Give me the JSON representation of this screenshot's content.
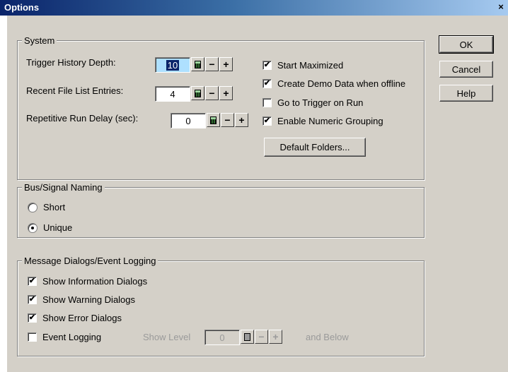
{
  "window": {
    "title": "Options",
    "close": "×"
  },
  "buttons": {
    "ok": "OK",
    "cancel": "Cancel",
    "help": "Help"
  },
  "system": {
    "title": "System",
    "trigger_history": {
      "label": "Trigger History Depth:",
      "value": "10"
    },
    "recent_files": {
      "label": "Recent File List Entries:",
      "value": "4"
    },
    "run_delay": {
      "label": "Repetitive Run Delay (sec):",
      "value": "0"
    },
    "options": {
      "start_maximized": "Start Maximized",
      "demo_data": "Create Demo Data when offline",
      "goto_trigger": "Go to Trigger on Run",
      "numeric_grouping": "Enable Numeric Grouping"
    },
    "default_folders": "Default Folders..."
  },
  "naming": {
    "title": "Bus/Signal Naming",
    "short": "Short",
    "unique": "Unique"
  },
  "dialogs": {
    "title": "Message Dialogs/Event Logging",
    "show_info": "Show Information Dialogs",
    "show_warning": "Show Warning Dialogs",
    "show_error": "Show Error Dialogs",
    "event_logging": "Event Logging",
    "show_level": "Show Level",
    "level_value": "0",
    "and_below": "and Below"
  },
  "spin": {
    "minus": "−",
    "plus": "+"
  },
  "check": "✔"
}
